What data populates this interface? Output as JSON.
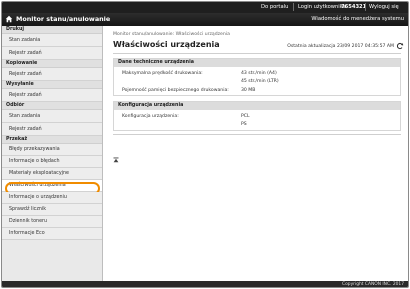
{
  "topbar": {
    "portal_link": "Do portalu",
    "user_label": "Login użytkownika:",
    "user_id": "7654321",
    "logout_link": "Wyloguj się",
    "admin_mail": "Wiadomość do menedżera systemu"
  },
  "header": {
    "title": "Monitor stanu/anulowanie"
  },
  "sidebar": {
    "sections": [
      {
        "label": "Drukuj",
        "items": [
          "Stan zadania",
          "Rejestr zadań"
        ]
      },
      {
        "label": "Kopiowanie",
        "items": [
          "Rejestr zadań"
        ]
      },
      {
        "label": "Wysyłanie",
        "items": [
          "Rejestr zadań"
        ]
      },
      {
        "label": "Odbiór",
        "items": [
          "Stan zadania",
          "Rejestr zadań"
        ]
      },
      {
        "label": "Przekaż",
        "items": [
          "Błędy przekazywania",
          "Informacje o błędach",
          "Materiały eksploatacyjne",
          "Właściwości urządzenia",
          "Informacje o urządzeniu",
          "Sprawdź licznik",
          "Dziennik toneru",
          "Informacje Eco"
        ]
      }
    ],
    "selected": "Właściwości urządzenia"
  },
  "main": {
    "breadcrumb": "Monitor stanu/anulowanie: Właściwości urządzenia",
    "page_title": "Właściwości urządzenia",
    "last_updated": "Ostatnia aktualizacja 23/09 2017 04:35:57 AM",
    "sections": [
      {
        "title": "Dane techniczne urządzenia",
        "rows": [
          {
            "label": "Maksymalna prędkość drukowania:",
            "values": [
              "43 str./min (A4)",
              "45 str./min (LTR)"
            ]
          },
          {
            "label": "Pojemność pamięci bezpiecznego drukowania:",
            "values": [
              "30 MB"
            ]
          }
        ]
      },
      {
        "title": "Konfiguracja urządzenia",
        "rows": [
          {
            "label": "Konfiguracja urządzenia:",
            "values": [
              "PCL",
              "PS"
            ]
          }
        ]
      }
    ]
  },
  "footer": {
    "copyright": "Copyright CANON INC. 2017"
  },
  "colors": {
    "topbar": "#1f1f1f",
    "sidebar_bg": "#e9e9e9",
    "highlight": "#f08c00",
    "section_head": "#dcdcdc"
  }
}
